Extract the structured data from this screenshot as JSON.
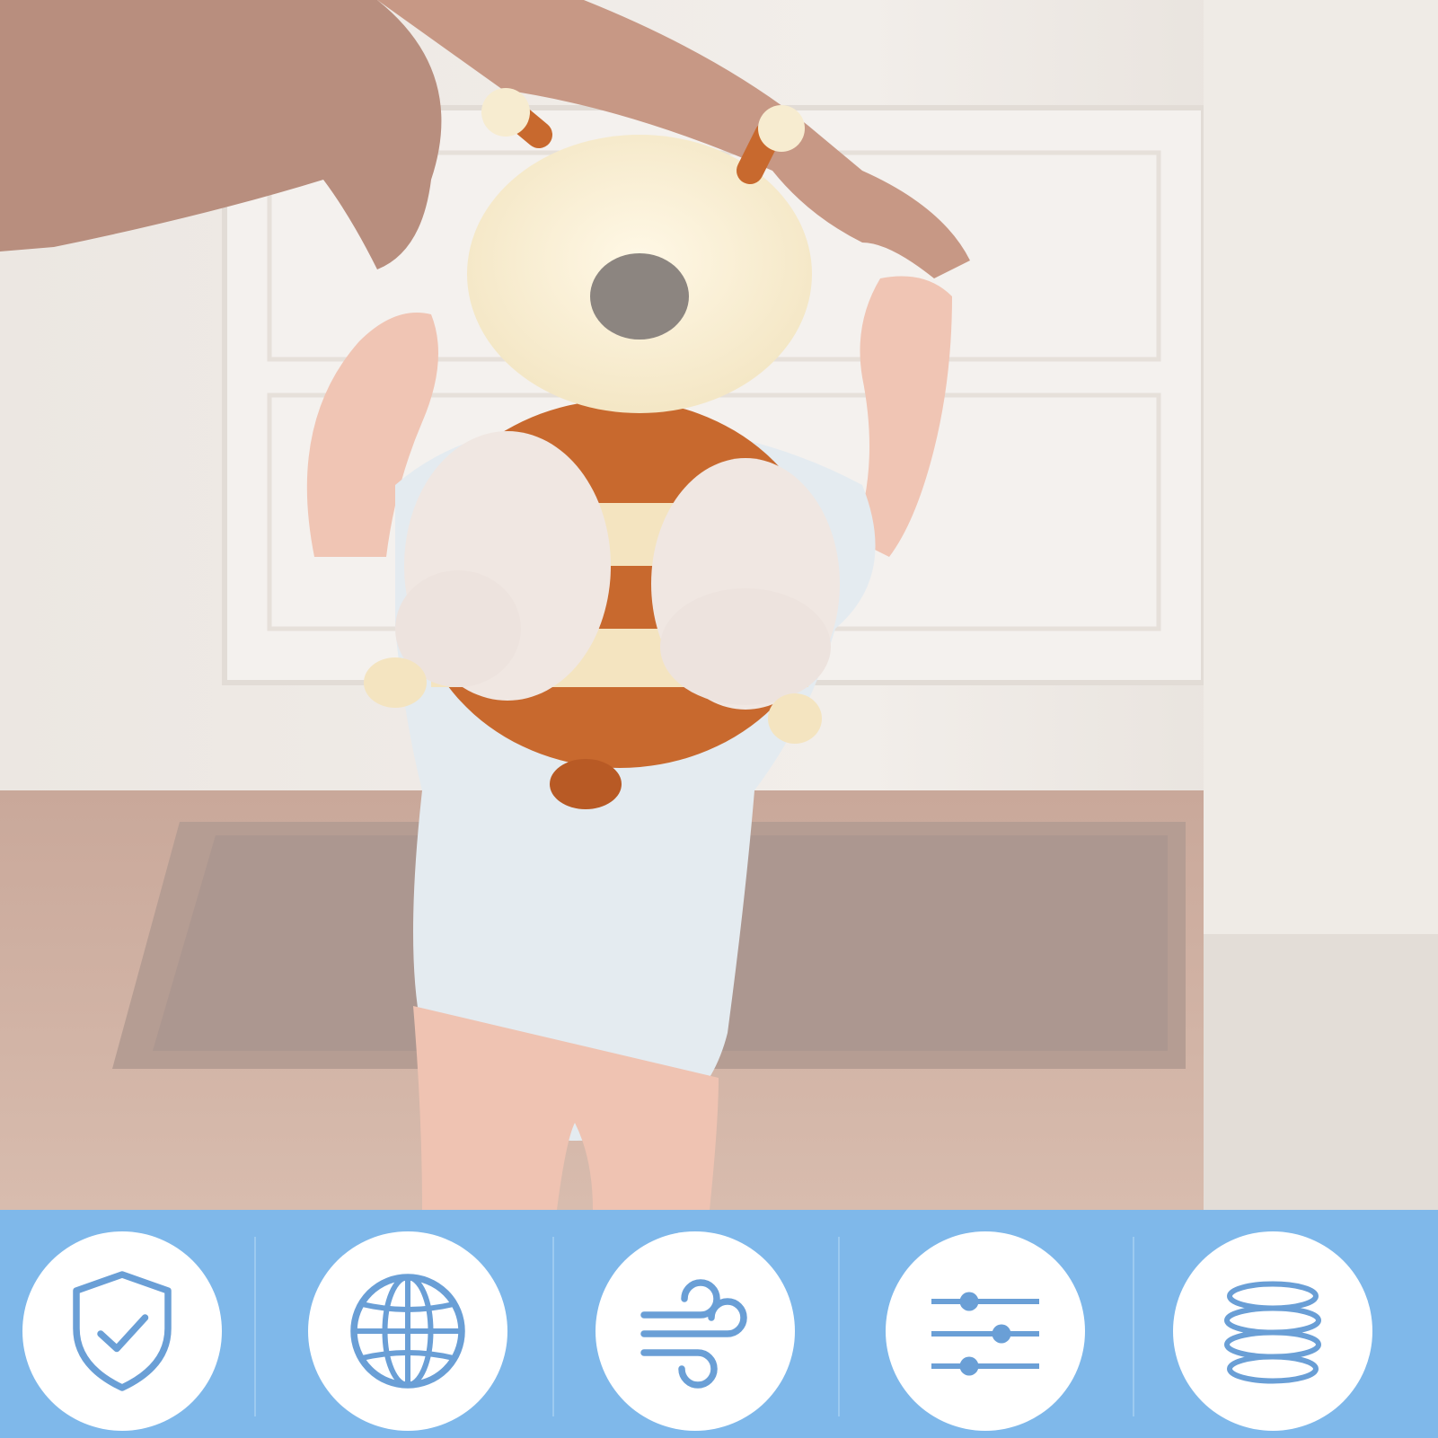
{
  "colors": {
    "band_background": "#7fb8ea",
    "band_divider": "#9ccaf0",
    "icon_stroke": "#6a9fd6",
    "badge_fill": "#ffffff"
  },
  "icons": [
    {
      "name": "shield-check-icon"
    },
    {
      "name": "globe-icon"
    },
    {
      "name": "wind-airflow-icon"
    },
    {
      "name": "adjustment-sliders-icon"
    },
    {
      "name": "spring-coil-icon"
    }
  ]
}
